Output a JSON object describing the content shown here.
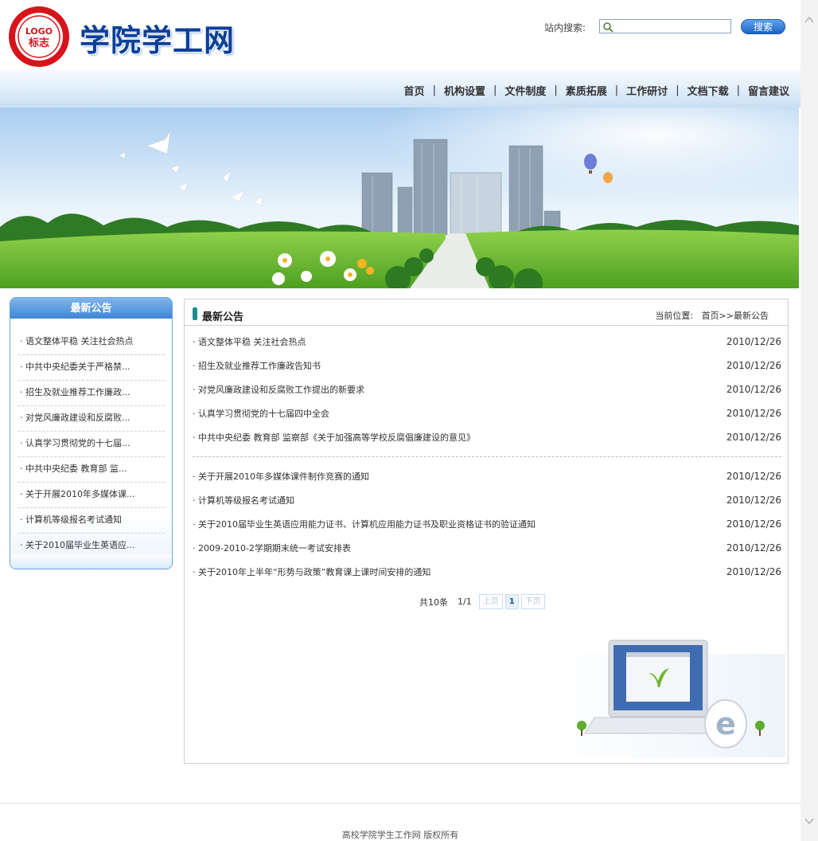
{
  "header": {
    "logo_text": "LOGO",
    "logo_subtext": "标志",
    "site_title": "学院学工网",
    "search_label": "站内搜索:",
    "search_value": "",
    "search_button": "搜索"
  },
  "nav": {
    "items": [
      "首页",
      "机构设置",
      "文件制度",
      "素质拓展",
      "工作研讨",
      "文档下载",
      "留言建议"
    ],
    "separator": "|"
  },
  "sidebar": {
    "title": "最新公告",
    "items": [
      "语文整体平稳 关注社会热点",
      "中共中央纪委关于严格禁...",
      "招生及就业推荐工作廉政...",
      "对党风廉政建设和反腐败...",
      "认真学习贯彻党的十七届...",
      "中共中央纪委 教育部 监...",
      "关于开展2010年多媒体课...",
      "计算机等级报名考试通知",
      "关于2010届毕业生英语应..."
    ]
  },
  "main": {
    "title": "最新公告",
    "breadcrumb_label": "当前位置:",
    "breadcrumb_path": "首页>>最新公告",
    "group1": [
      {
        "title": "· 语文整体平稳 关注社会热点",
        "date": "2010/12/26"
      },
      {
        "title": "· 招生及就业推荐工作廉政告知书",
        "date": "2010/12/26"
      },
      {
        "title": "· 对党风廉政建设和反腐败工作提出的新要求",
        "date": "2010/12/26"
      },
      {
        "title": "· 认真学习贯彻党的十七届四中全会",
        "date": "2010/12/26"
      },
      {
        "title": "· 中共中央纪委 教育部 监察部《关于加强高等学校反腐倡廉建设的意见》",
        "date": "2010/12/26"
      }
    ],
    "group2": [
      {
        "title": "· 关于开展2010年多媒体课件制作竞赛的通知",
        "date": "2010/12/26"
      },
      {
        "title": "· 计算机等级报名考试通知",
        "date": "2010/12/26"
      },
      {
        "title": "· 关于2010届毕业生英语应用能力证书、计算机应用能力证书及职业资格证书的验证通知",
        "date": "2010/12/26"
      },
      {
        "title": "· 2009-2010-2学期期末统一考试安排表",
        "date": "2010/12/26"
      },
      {
        "title": "· 关于2010年上半年“形势与政策”教育课上课时间安排的通知",
        "date": "2010/12/26"
      }
    ],
    "pager": {
      "total": "共10条",
      "pages": "1/1",
      "prev": "上页",
      "current": "1",
      "next": "下页"
    }
  },
  "footer": {
    "copyright": "高校学院学生工作网 版权所有"
  },
  "colors": {
    "brand_blue": "#0c3f98",
    "nav_bg": "#dbe9f7",
    "sidebar_head": "#3f86d6",
    "marker_teal": "#1f8c8c"
  }
}
